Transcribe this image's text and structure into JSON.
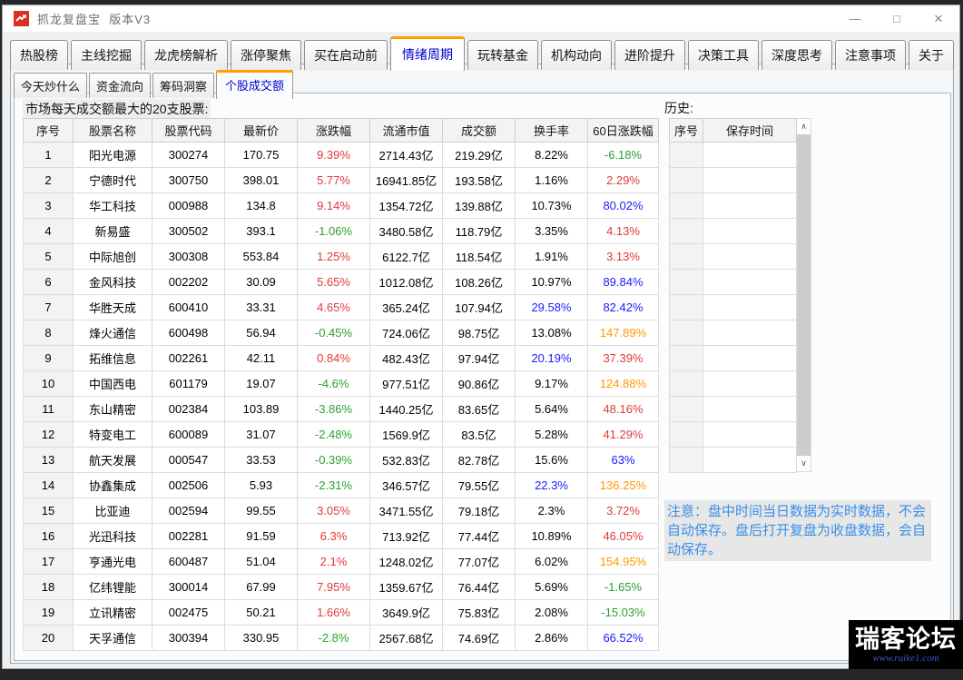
{
  "window": {
    "title": "抓龙复盘宝",
    "version": "版本V3",
    "minimize_glyph": "—",
    "maximize_glyph": "□",
    "close_glyph": "✕"
  },
  "icons": {
    "app_icon": "trend-up-chart",
    "scroll_up_glyph": "∧",
    "scroll_down_glyph": "∨"
  },
  "colors": {
    "accent_orange_tab": "#ffa000",
    "selected_tab_text": "#0000d0",
    "up_red": "#e03a3a",
    "down_green": "#2ca02c",
    "highlight_blue": "#1a1aff",
    "highlight_orange": "#ff9800",
    "note_blue": "#3a8fe8",
    "app_icon_red": "#d93025"
  },
  "main_tabs": [
    {
      "label": "热股榜",
      "selected": false
    },
    {
      "label": "主线挖掘",
      "selected": false
    },
    {
      "label": "龙虎榜解析",
      "selected": false
    },
    {
      "label": "涨停聚焦",
      "selected": false
    },
    {
      "label": "买在启动前",
      "selected": false
    },
    {
      "label": "情绪周期",
      "selected": true
    },
    {
      "label": "玩转基金",
      "selected": false
    },
    {
      "label": "机构动向",
      "selected": false
    },
    {
      "label": "进阶提升",
      "selected": false
    },
    {
      "label": "决策工具",
      "selected": false
    },
    {
      "label": "深度思考",
      "selected": false
    },
    {
      "label": "注意事项",
      "selected": false
    },
    {
      "label": "关于",
      "selected": false
    }
  ],
  "sub_tabs": [
    {
      "label": "今天炒什么",
      "selected": false
    },
    {
      "label": "资金流向",
      "selected": false
    },
    {
      "label": "筹码洞察",
      "selected": false
    },
    {
      "label": "个股成交额",
      "selected": true
    }
  ],
  "lede": "市场每天成交额最大的20支股票:",
  "main_table": {
    "columns": [
      "序号",
      "股票名称",
      "股票代码",
      "最新价",
      "涨跌幅",
      "流通市值",
      "成交额",
      "换手率",
      "60日涨跌幅"
    ],
    "rows": [
      {
        "seq": "1",
        "name": "阳光电源",
        "code": "300274",
        "price": "170.75",
        "change": "9.39%",
        "change_color": "red",
        "float_cap": "2714.43亿",
        "amount": "219.29亿",
        "turnover": "8.22%",
        "turnover_color": "black",
        "chg60": "-6.18%",
        "chg60_color": "green"
      },
      {
        "seq": "2",
        "name": "宁德时代",
        "code": "300750",
        "price": "398.01",
        "change": "5.77%",
        "change_color": "red",
        "float_cap": "16941.85亿",
        "amount": "193.58亿",
        "turnover": "1.16%",
        "turnover_color": "black",
        "chg60": "2.29%",
        "chg60_color": "red"
      },
      {
        "seq": "3",
        "name": "华工科技",
        "code": "000988",
        "price": "134.8",
        "change": "9.14%",
        "change_color": "red",
        "float_cap": "1354.72亿",
        "amount": "139.88亿",
        "turnover": "10.73%",
        "turnover_color": "black",
        "chg60": "80.02%",
        "chg60_color": "blue"
      },
      {
        "seq": "4",
        "name": "新易盛",
        "code": "300502",
        "price": "393.1",
        "change": "-1.06%",
        "change_color": "green",
        "float_cap": "3480.58亿",
        "amount": "118.79亿",
        "turnover": "3.35%",
        "turnover_color": "black",
        "chg60": "4.13%",
        "chg60_color": "red"
      },
      {
        "seq": "5",
        "name": "中际旭创",
        "code": "300308",
        "price": "553.84",
        "change": "1.25%",
        "change_color": "red",
        "float_cap": "6122.7亿",
        "amount": "118.54亿",
        "turnover": "1.91%",
        "turnover_color": "black",
        "chg60": "3.13%",
        "chg60_color": "red"
      },
      {
        "seq": "6",
        "name": "金风科技",
        "code": "002202",
        "price": "30.09",
        "change": "5.65%",
        "change_color": "red",
        "float_cap": "1012.08亿",
        "amount": "108.26亿",
        "turnover": "10.97%",
        "turnover_color": "black",
        "chg60": "89.84%",
        "chg60_color": "blue"
      },
      {
        "seq": "7",
        "name": "华胜天成",
        "code": "600410",
        "price": "33.31",
        "change": "4.65%",
        "change_color": "red",
        "float_cap": "365.24亿",
        "amount": "107.94亿",
        "turnover": "29.58%",
        "turnover_color": "blue",
        "chg60": "82.42%",
        "chg60_color": "blue"
      },
      {
        "seq": "8",
        "name": "烽火通信",
        "code": "600498",
        "price": "56.94",
        "change": "-0.45%",
        "change_color": "green",
        "float_cap": "724.06亿",
        "amount": "98.75亿",
        "turnover": "13.08%",
        "turnover_color": "black",
        "chg60": "147.89%",
        "chg60_color": "orange"
      },
      {
        "seq": "9",
        "name": "拓维信息",
        "code": "002261",
        "price": "42.11",
        "change": "0.84%",
        "change_color": "red",
        "float_cap": "482.43亿",
        "amount": "97.94亿",
        "turnover": "20.19%",
        "turnover_color": "blue",
        "chg60": "37.39%",
        "chg60_color": "red"
      },
      {
        "seq": "10",
        "name": "中国西电",
        "code": "601179",
        "price": "19.07",
        "change": "-4.6%",
        "change_color": "green",
        "float_cap": "977.51亿",
        "amount": "90.86亿",
        "turnover": "9.17%",
        "turnover_color": "black",
        "chg60": "124.88%",
        "chg60_color": "orange"
      },
      {
        "seq": "11",
        "name": "东山精密",
        "code": "002384",
        "price": "103.89",
        "change": "-3.86%",
        "change_color": "green",
        "float_cap": "1440.25亿",
        "amount": "83.65亿",
        "turnover": "5.64%",
        "turnover_color": "black",
        "chg60": "48.16%",
        "chg60_color": "red"
      },
      {
        "seq": "12",
        "name": "特变电工",
        "code": "600089",
        "price": "31.07",
        "change": "-2.48%",
        "change_color": "green",
        "float_cap": "1569.9亿",
        "amount": "83.5亿",
        "turnover": "5.28%",
        "turnover_color": "black",
        "chg60": "41.29%",
        "chg60_color": "red"
      },
      {
        "seq": "13",
        "name": "航天发展",
        "code": "000547",
        "price": "33.53",
        "change": "-0.39%",
        "change_color": "green",
        "float_cap": "532.83亿",
        "amount": "82.78亿",
        "turnover": "15.6%",
        "turnover_color": "black",
        "chg60": "63%",
        "chg60_color": "blue"
      },
      {
        "seq": "14",
        "name": "协鑫集成",
        "code": "002506",
        "price": "5.93",
        "change": "-2.31%",
        "change_color": "green",
        "float_cap": "346.57亿",
        "amount": "79.55亿",
        "turnover": "22.3%",
        "turnover_color": "blue",
        "chg60": "136.25%",
        "chg60_color": "orange"
      },
      {
        "seq": "15",
        "name": "比亚迪",
        "code": "002594",
        "price": "99.55",
        "change": "3.05%",
        "change_color": "red",
        "float_cap": "3471.55亿",
        "amount": "79.18亿",
        "turnover": "2.3%",
        "turnover_color": "black",
        "chg60": "3.72%",
        "chg60_color": "red"
      },
      {
        "seq": "16",
        "name": "光迅科技",
        "code": "002281",
        "price": "91.59",
        "change": "6.3%",
        "change_color": "red",
        "float_cap": "713.92亿",
        "amount": "77.44亿",
        "turnover": "10.89%",
        "turnover_color": "black",
        "chg60": "46.05%",
        "chg60_color": "red"
      },
      {
        "seq": "17",
        "name": "亨通光电",
        "code": "600487",
        "price": "51.04",
        "change": "2.1%",
        "change_color": "red",
        "float_cap": "1248.02亿",
        "amount": "77.07亿",
        "turnover": "6.02%",
        "turnover_color": "black",
        "chg60": "154.95%",
        "chg60_color": "orange"
      },
      {
        "seq": "18",
        "name": "亿纬锂能",
        "code": "300014",
        "price": "67.99",
        "change": "7.95%",
        "change_color": "red",
        "float_cap": "1359.67亿",
        "amount": "76.44亿",
        "turnover": "5.69%",
        "turnover_color": "black",
        "chg60": "-1.65%",
        "chg60_color": "green"
      },
      {
        "seq": "19",
        "name": "立讯精密",
        "code": "002475",
        "price": "50.21",
        "change": "1.66%",
        "change_color": "red",
        "float_cap": "3649.9亿",
        "amount": "75.83亿",
        "turnover": "2.08%",
        "turnover_color": "black",
        "chg60": "-15.03%",
        "chg60_color": "green"
      },
      {
        "seq": "20",
        "name": "天孚通信",
        "code": "300394",
        "price": "330.95",
        "change": "-2.8%",
        "change_color": "green",
        "float_cap": "2567.68亿",
        "amount": "74.69亿",
        "turnover": "2.86%",
        "turnover_color": "black",
        "chg60": "66.52%",
        "chg60_color": "blue"
      }
    ]
  },
  "history": {
    "label": "历史:",
    "columns": [
      "序号",
      "保存时间"
    ],
    "empty_row_count": 13
  },
  "note": "注意：盘中时间当日数据为实时数据，不会自动保存。盘后打开复盘为收盘数据，会自动保存。",
  "watermark": {
    "line1": "瑞客论坛",
    "line2": "www.ruike1.com"
  }
}
